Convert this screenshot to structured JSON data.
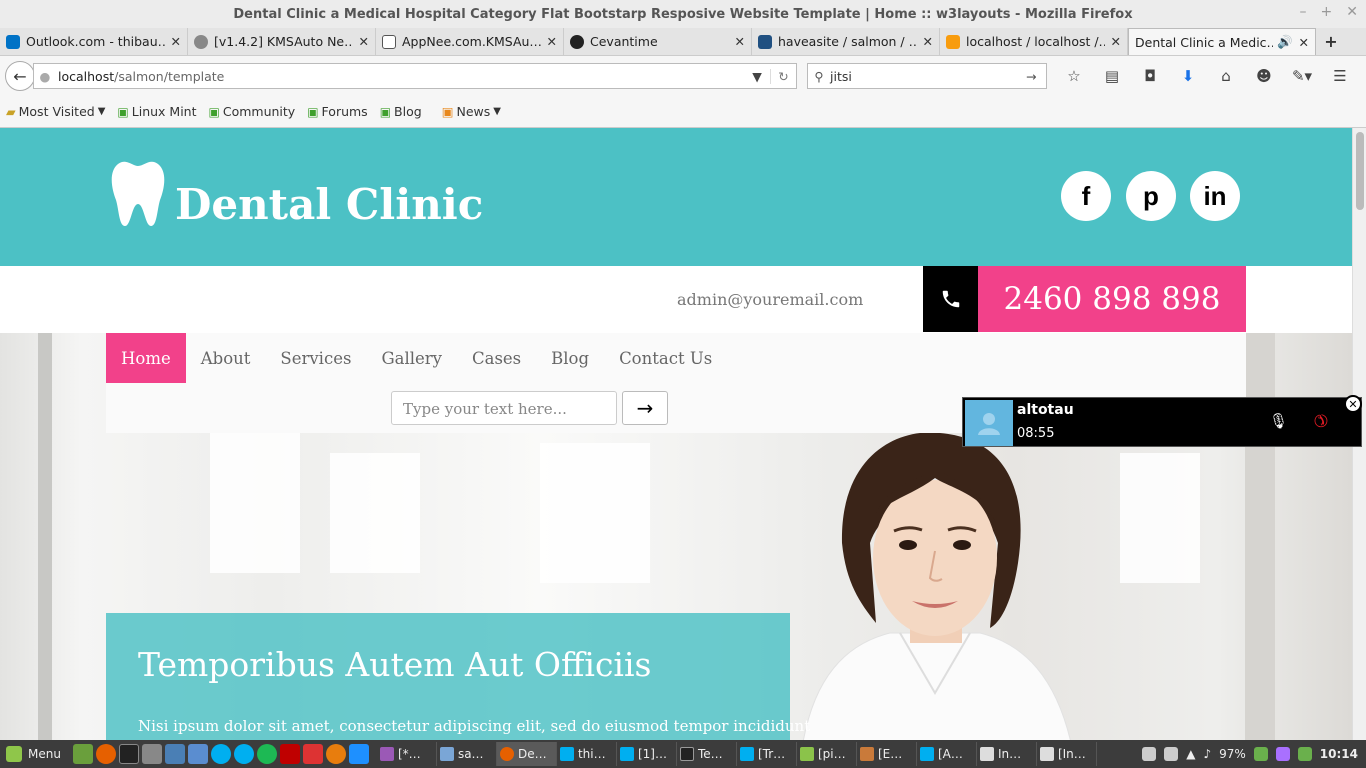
{
  "window": {
    "title": "Dental Clinic a Medical Hospital Category Flat Bootstarp Resposive Website Template | Home :: w3layouts - Mozilla Firefox"
  },
  "tabs": [
    {
      "label": "Outlook.com - thibau…",
      "color": "#0072c6"
    },
    {
      "label": "[v1.4.2] KMSAuto Ne…",
      "color": "#888888"
    },
    {
      "label": "AppNee.com.KMSAu…",
      "color": "#555555"
    },
    {
      "label": "Cevantime",
      "color": "#222222"
    },
    {
      "label": "haveasite / salmon / …",
      "color": "#205081"
    },
    {
      "label": "localhost / localhost /…",
      "color": "#f89c0e"
    },
    {
      "label": "Dental Clinic a Medic…",
      "color": "#4cc1c5",
      "active": true
    }
  ],
  "urlbar": {
    "host": "localhost",
    "path": "/salmon/template"
  },
  "searchbar": {
    "value": "jitsi"
  },
  "bookmarks": [
    "Most Visited",
    "Linux Mint",
    "Community",
    "Forums",
    "Blog",
    "News"
  ],
  "site": {
    "brand": "Dental Clinic",
    "social": [
      "f",
      "p",
      "in"
    ],
    "email": "admin@youremail.com",
    "phone": "2460 898 898",
    "menu": [
      "Home",
      "About",
      "Services",
      "Gallery",
      "Cases",
      "Blog",
      "Contact Us"
    ],
    "search_placeholder": "Type your text here...",
    "hero_title": "Temporibus Autem Aut Officiis",
    "hero_text": "Nisi ipsum dolor sit amet, consectetur adipiscing elit, sed do eiusmod tempor incididunt",
    "colors": {
      "teal": "#4cc1c5",
      "pink": "#f2418a"
    }
  },
  "call": {
    "name": "altotau",
    "time": "08:55"
  },
  "taskbar": {
    "menu_label": "Menu",
    "tasks": [
      "[*…",
      "sa…",
      "De…",
      "thi…",
      "[1]…",
      "Te…",
      "[Tr…",
      "[pi…",
      "[E…",
      "[A…",
      "In…",
      "[In…"
    ],
    "battery": "97%",
    "clock": "10:14"
  }
}
